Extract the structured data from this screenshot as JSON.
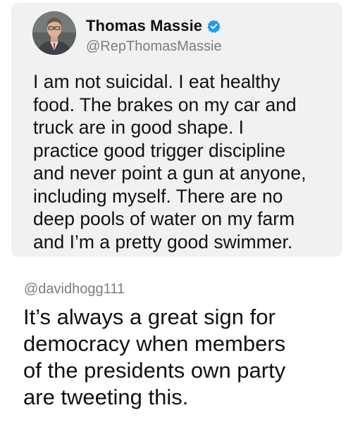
{
  "quoted_tweet": {
    "author_name": "Thomas Massie",
    "author_handle": "@RepThomasMassie",
    "verified": true,
    "text": "I am not suicidal. I eat healthy\nfood. The brakes on my car and\ntruck are in good shape. I\npractice good trigger discipline\nand never point a gun at anyone,\nincluding myself. There are no\ndeep pools of water on my farm\nand I’m a pretty good swimmer."
  },
  "reply": {
    "author_handle": "@davidhogg111",
    "text": "It’s always a great sign for\ndemocracy when members\nof the presidents own party\nare tweeting this."
  },
  "colors": {
    "card_background": "#f1f1f2",
    "verified_blue": "#1d9bf0",
    "handle_gray": "#7a7d80",
    "text_primary": "#111111"
  },
  "icons": {
    "verified": "verified-badge-icon",
    "avatar": "profile-photo"
  }
}
